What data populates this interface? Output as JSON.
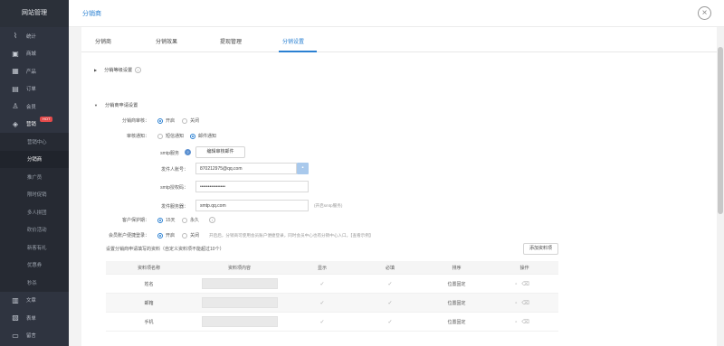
{
  "sidebar": {
    "title": "网站管理",
    "items": [
      {
        "label": "统计",
        "icon": "chart-line-icon"
      },
      {
        "label": "商城",
        "icon": "shop-icon"
      },
      {
        "label": "产品",
        "icon": "grid-icon"
      },
      {
        "label": "订单",
        "icon": "clipboard-icon"
      },
      {
        "label": "会员",
        "icon": "member-icon"
      },
      {
        "label": "营销",
        "icon": "tag-icon",
        "badge": "HOT"
      }
    ],
    "submenu": [
      "营销中心",
      "分销商",
      "推广员",
      "限时促销",
      "多人拼团",
      "砍价活动",
      "新客有礼",
      "优惠券",
      "秒杀"
    ],
    "bottom_items": [
      {
        "label": "文章",
        "icon": "article-icon"
      },
      {
        "label": "表单",
        "icon": "form-icon"
      },
      {
        "label": "留言",
        "icon": "message-icon"
      },
      {
        "label": "图片",
        "icon": "image-icon"
      }
    ]
  },
  "header": {
    "breadcrumb": "分销商"
  },
  "tabs": [
    "分销商",
    "分销效果",
    "提现管理",
    "分销设置"
  ],
  "sections": {
    "level": "分销等级设置",
    "apply": "分销商申请设置"
  },
  "form": {
    "audit_label": "分销商审核：",
    "audit_on": "开启",
    "audit_off": "关闭",
    "notify_label": "审核通知：",
    "notify_sms": "短信通知",
    "notify_mail": "邮件通知",
    "smtp_label": "smtp服务",
    "smtp_btn": "编辑审核邮件",
    "sender_label": "发件人账号：",
    "sender_value": "870212975@qq.com",
    "auth_label": "smtp授权码：",
    "auth_value": "••••••••••••••••",
    "server_label": "发件服务器：",
    "server_value": "smtp.qq.com",
    "server_hint": "(开启smtp服务)",
    "protect_label": "客户保护期：",
    "protect_15": "15天",
    "protect_forever": "永久",
    "fast_label": "会员账户便捷登录：",
    "fast_on": "开启",
    "fast_off": "关闭",
    "fast_hint": "开启后，分销商可使用会员账户便捷登录，同时会员中心也有分销中心入口。【查看示例】",
    "fields_label": "设置分销商申请填写的资料（自定义资料项不能超过10个）",
    "add_btn": "添加资料项"
  },
  "table": {
    "headers": [
      "资料项名称",
      "资料项内容",
      "显示",
      "必填",
      "排序",
      "操作"
    ],
    "rows": [
      {
        "name": "姓名",
        "sort": "位置固定"
      },
      {
        "name": "邮箱",
        "sort": "位置固定"
      },
      {
        "name": "手机",
        "sort": "位置固定"
      }
    ]
  },
  "colors": {
    "accent": "#2a80d2",
    "sidebar": "#2f3440",
    "hot": "#e34a4a"
  }
}
